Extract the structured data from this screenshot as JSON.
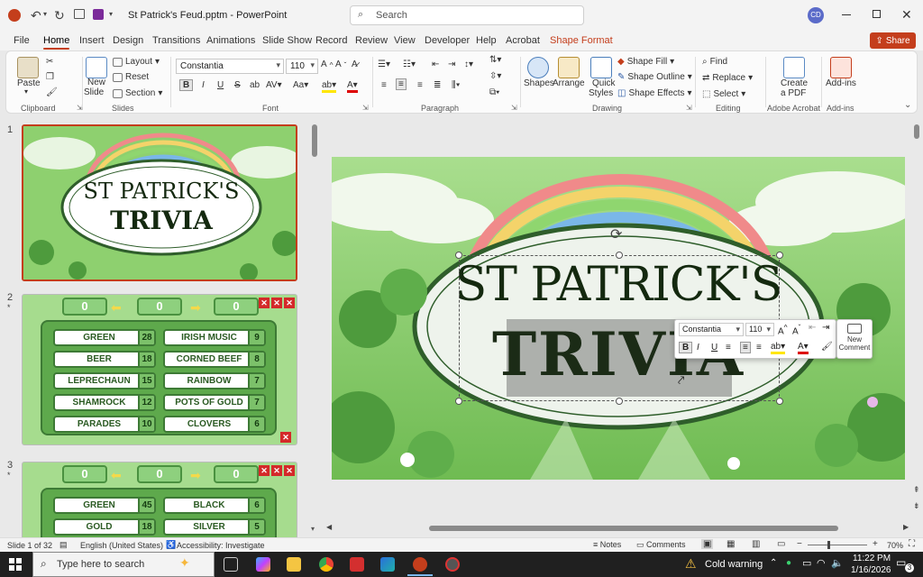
{
  "titlebar": {
    "filename": "St Patrick's Feud.pptm",
    "sep": "-",
    "app": "PowerPoint",
    "search_placeholder": "Search",
    "user_initials": "CD"
  },
  "menu": {
    "tabs": [
      "File",
      "Home",
      "Insert",
      "Design",
      "Transitions",
      "Animations",
      "Slide Show",
      "Record",
      "Review",
      "View",
      "Developer",
      "Help",
      "Acrobat",
      "Shape Format"
    ],
    "share_label": "Share"
  },
  "ribbon": {
    "clipboard": {
      "paste": "Paste",
      "label": "Clipboard"
    },
    "slides": {
      "new_slide": "New",
      "new_slide2": "Slide",
      "layout": "Layout",
      "reset": "Reset",
      "section": "Section",
      "label": "Slides"
    },
    "font": {
      "family": "Constantia",
      "size": "110",
      "label": "Font"
    },
    "paragraph": {
      "label": "Paragraph"
    },
    "drawing": {
      "shapes": "Shapes",
      "arrange": "Arrange",
      "quick_styles": "Quick",
      "quick_styles2": "Styles",
      "shape_fill": "Shape Fill",
      "shape_outline": "Shape Outline",
      "shape_effects": "Shape Effects",
      "label": "Drawing"
    },
    "editing": {
      "find": "Find",
      "replace": "Replace",
      "select": "Select",
      "label": "Editing"
    },
    "acrobat": {
      "create_pdf": "Create",
      "create_pdf2": "a PDF",
      "label": "Adobe Acrobat"
    },
    "addins": {
      "addins": "Add-ins",
      "label": "Add-ins"
    }
  },
  "thumbnails": [
    {
      "num": "1",
      "line1": "ST PATRICK'S",
      "line2": "TRIVIA"
    },
    {
      "num": "2",
      "round": "0",
      "team1": "0",
      "team2": "0",
      "left": [
        [
          "GREEN",
          "28"
        ],
        [
          "BEER",
          "18"
        ],
        [
          "LEPRECHAUN",
          "15"
        ],
        [
          "SHAMROCK",
          "12"
        ],
        [
          "PARADES",
          "10"
        ]
      ],
      "right": [
        [
          "IRISH MUSIC",
          "9"
        ],
        [
          "CORNED BEEF",
          "8"
        ],
        [
          "RAINBOW",
          "7"
        ],
        [
          "POTS OF GOLD",
          "7"
        ],
        [
          "CLOVERS",
          "6"
        ]
      ]
    },
    {
      "num": "3",
      "round": "0",
      "team1": "0",
      "team2": "0",
      "left": [
        [
          "GREEN",
          "45"
        ],
        [
          "GOLD",
          "18"
        ]
      ],
      "right": [
        [
          "BLACK",
          "6"
        ],
        [
          "SILVER",
          "5"
        ]
      ]
    }
  ],
  "slide": {
    "line1": "ST PATRICK'S",
    "line2": "TRIVIA"
  },
  "minitoolbar": {
    "font": "Constantia",
    "size": "110",
    "new_comment": "New",
    "new_comment2": "Comment"
  },
  "status": {
    "slide_of": "Slide 1 of 32",
    "language": "English (United States)",
    "accessibility": "Accessibility: Investigate",
    "notes": "Notes",
    "comments": "Comments",
    "zoom": "70%"
  },
  "taskbar": {
    "search_placeholder": "Type here to search",
    "weather": "Cold warning",
    "time": "11:22 PM",
    "date": "1/16/2026",
    "notif": "3"
  }
}
